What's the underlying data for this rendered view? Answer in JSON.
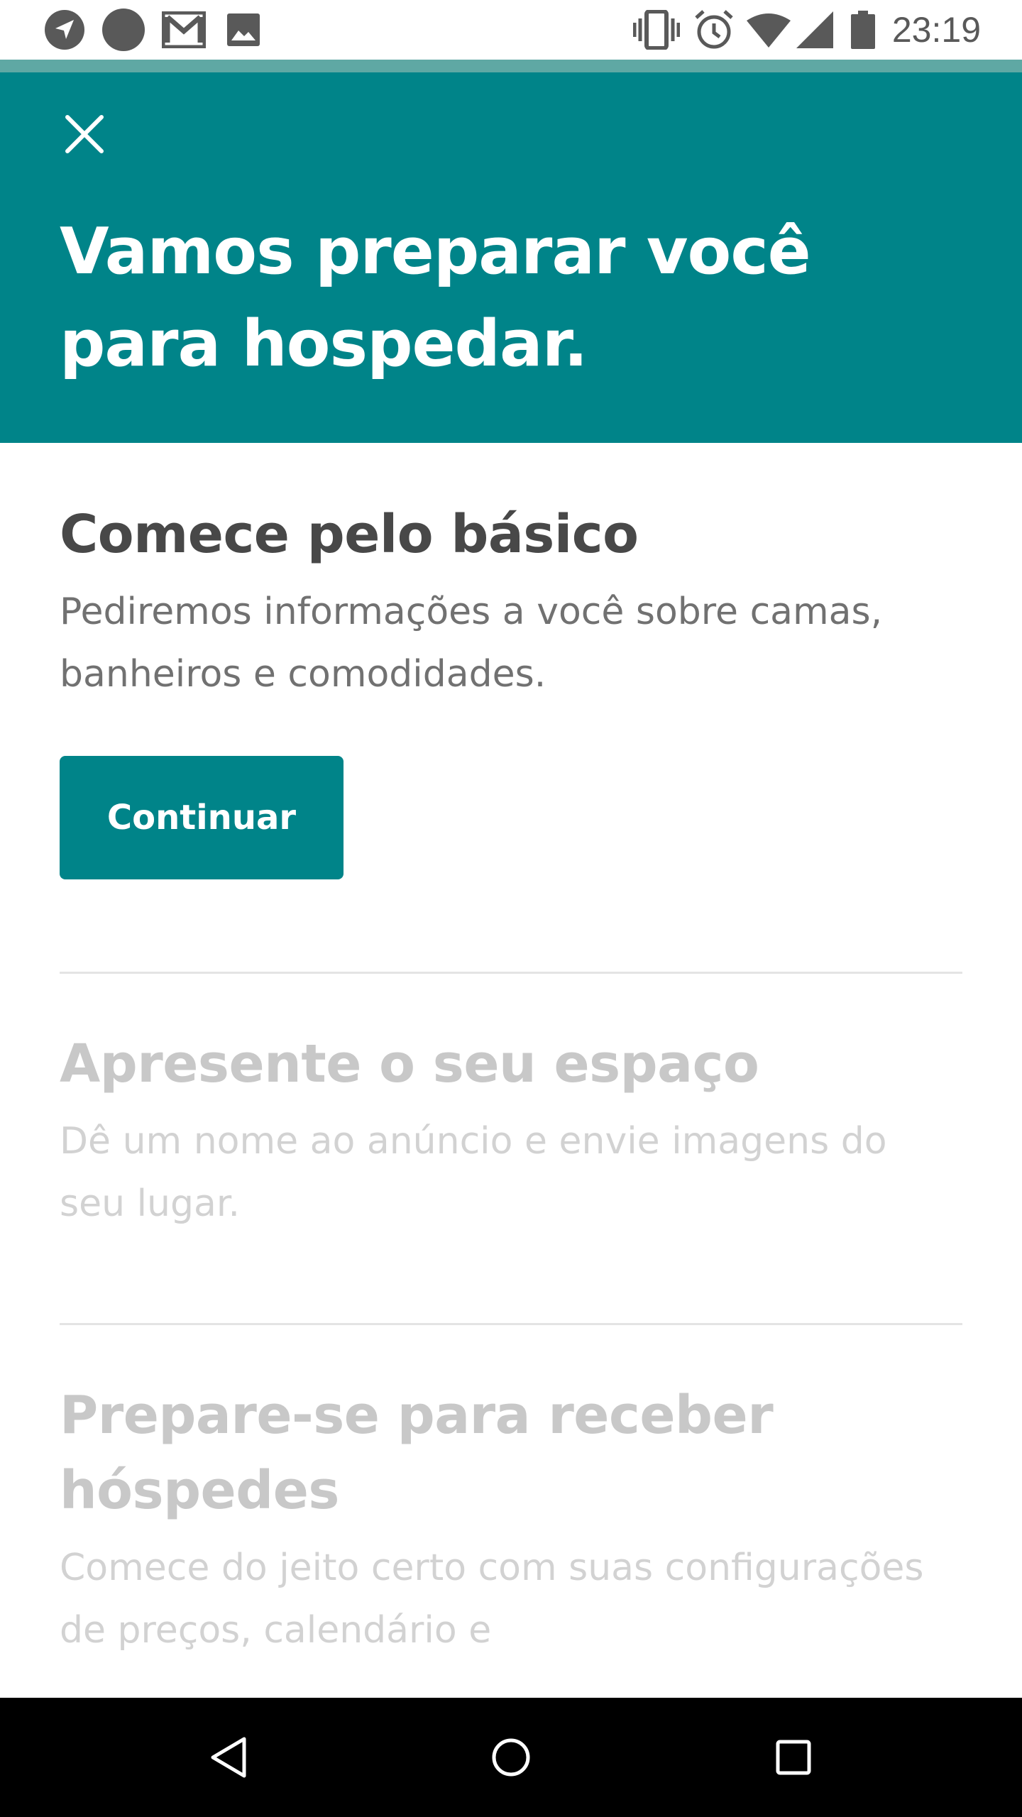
{
  "status_bar": {
    "time": "23:19",
    "left_icons": [
      "navigation-icon",
      "circle-icon",
      "gmail-icon",
      "image-icon"
    ],
    "right_icons": [
      "vibrate-icon",
      "alarm-icon",
      "wifi-icon",
      "signal-icon",
      "battery-icon"
    ]
  },
  "header": {
    "title": "Vamos preparar você para hospedar.",
    "background_color": "#008489"
  },
  "steps": [
    {
      "title": "Comece pelo básico",
      "description": "Pediremos informações a você sobre camas, banheiros e comodidades.",
      "button_label": "Continuar",
      "state": "active"
    },
    {
      "title": "Apresente o seu espaço",
      "description": "Dê um nome ao anúncio e envie imagens do seu lugar.",
      "state": "disabled"
    },
    {
      "title": "Prepare-se para receber hóspedes",
      "description": "Comece do jeito certo com suas configurações de preços, calendário e",
      "state": "disabled"
    }
  ],
  "nav_bar": {
    "buttons": [
      "back-icon",
      "home-icon",
      "recents-icon"
    ]
  },
  "colors": {
    "brand": "#008489",
    "text_dark": "#484848",
    "text_muted": "#c8c8c8"
  }
}
